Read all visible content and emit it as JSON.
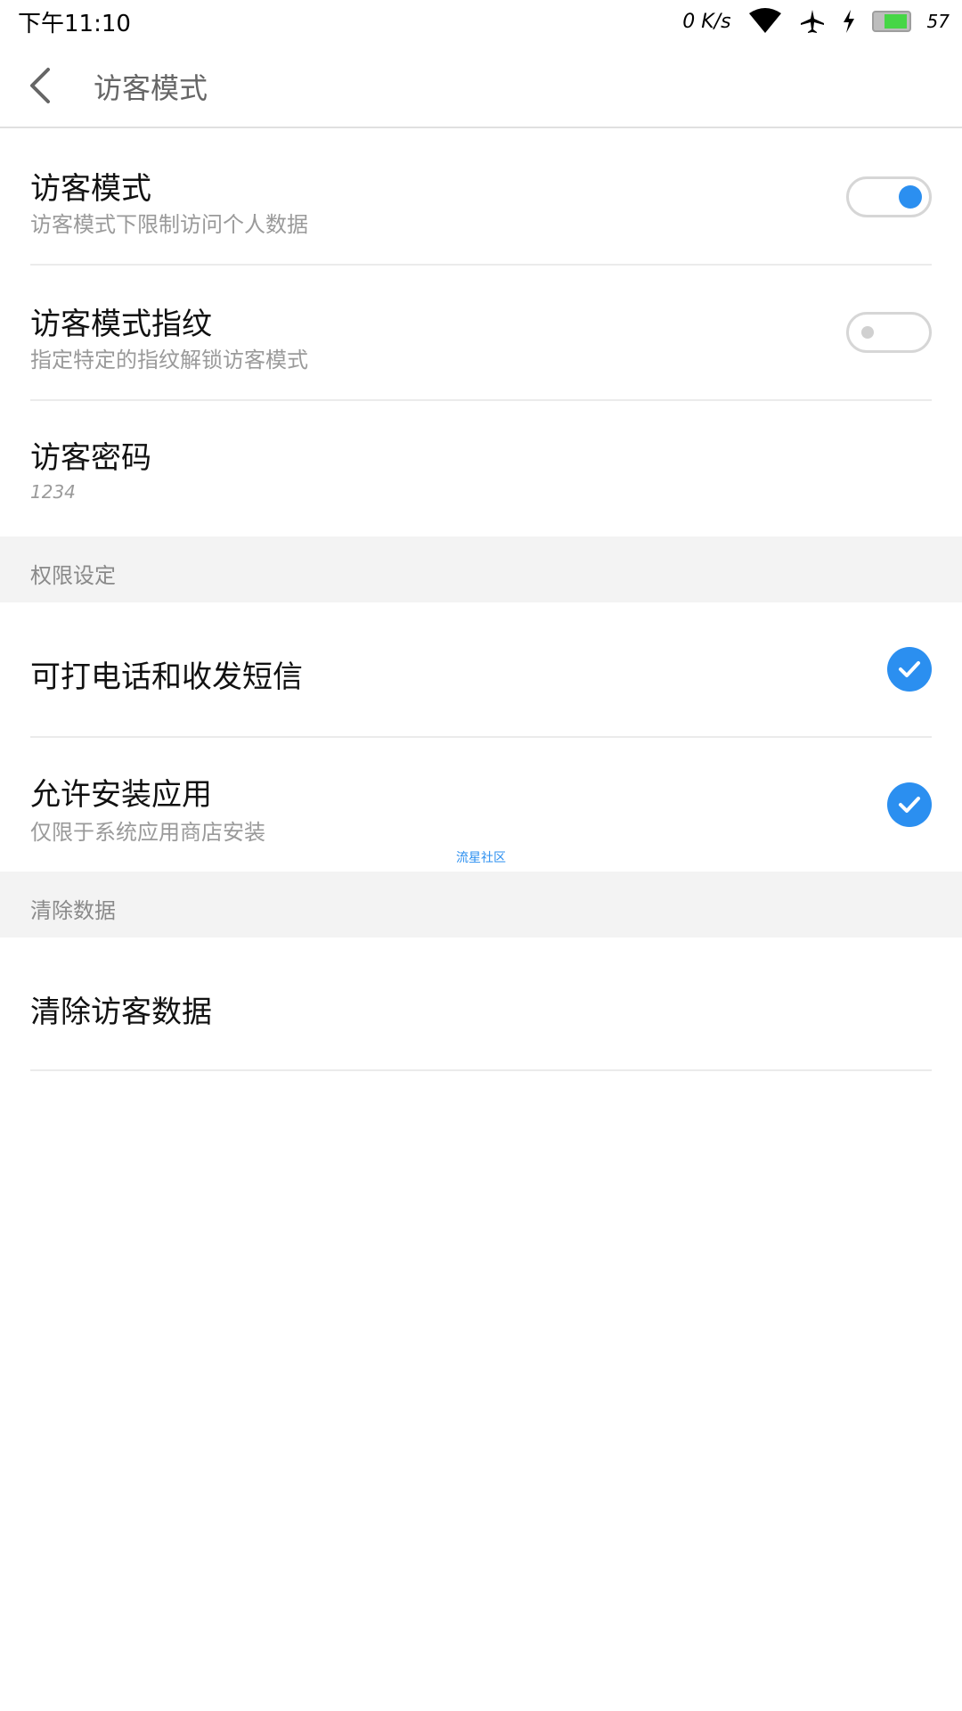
{
  "status_bar": {
    "time": "下午11:10",
    "net_speed": "0 K/s",
    "battery_level": "57",
    "icons": [
      "wifi-icon",
      "airplane-icon",
      "charging-icon",
      "battery-icon"
    ]
  },
  "app_bar": {
    "title": "访客模式",
    "back_icon": "back-arrow-icon"
  },
  "settings": [
    {
      "title": "访客模式",
      "subtitle": "访客模式下限制访问个人数据",
      "control": "toggle",
      "on": true
    },
    {
      "title": "访客模式指纹",
      "subtitle": "指定特定的指纹解锁访客模式",
      "control": "toggle",
      "on": false
    },
    {
      "title": "访客密码",
      "subtitle": "1234"
    }
  ],
  "permissions_section": {
    "header": "权限设定",
    "items": [
      {
        "title": "可打电话和收发短信",
        "checked": true
      },
      {
        "title": "允许安装应用",
        "subtitle": "仅限于系统应用商店安装",
        "checked": true
      }
    ]
  },
  "watermark": "流星社区",
  "clear_section": {
    "header": "清除数据",
    "items": [
      {
        "title": "清除访客数据"
      }
    ]
  },
  "colors": {
    "accent": "#2b8ff0",
    "divider": "#ebebeb",
    "section_bg": "#f3f3f3",
    "subtitle": "#9a9a9a"
  }
}
